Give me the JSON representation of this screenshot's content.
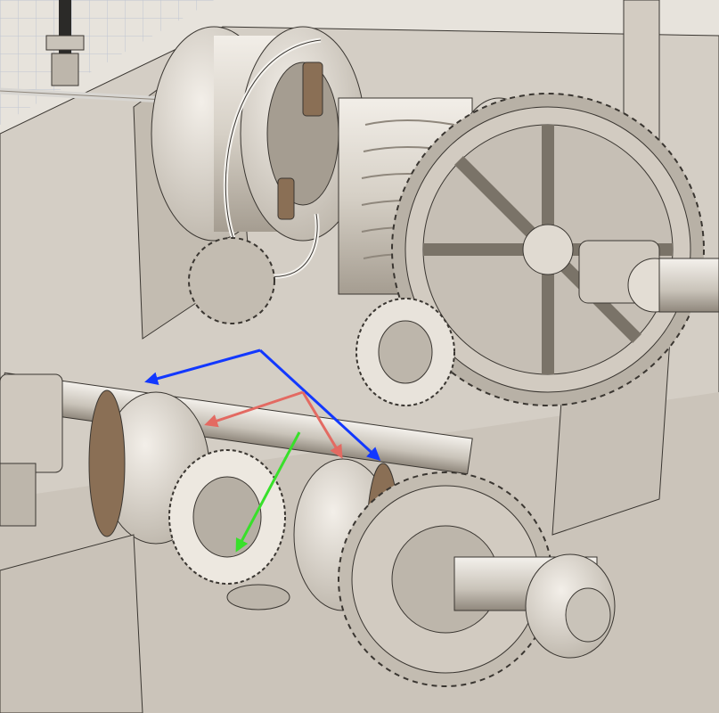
{
  "scene": {
    "subject": "gear-and-winch-drum-mechanism-render",
    "colors": {
      "background": "#e7e3dc",
      "metal_light": "#ebe7e0",
      "metal_mid": "#c9c3b9",
      "metal_dark": "#8f877c",
      "edge": "#3a3631",
      "bronze": "#8a6f55",
      "grid": "#bfc6d2",
      "cable": "#d8d6d2"
    },
    "annotations": {
      "blue_arrows": {
        "color": "#1238ff",
        "count": 2
      },
      "red_arrows": {
        "color": "#e36a62",
        "count": 2
      },
      "green_arrow": {
        "color": "#38e02a",
        "count": 1
      }
    }
  }
}
